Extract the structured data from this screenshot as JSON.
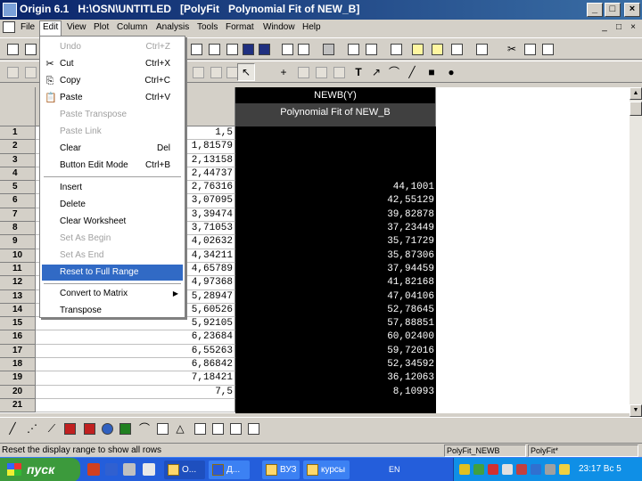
{
  "window": {
    "title": "Origin 6.1   H:\\OSN\\UNTITLED   [PolyFit   Polynomial Fit of NEW_B]",
    "minimize": "_",
    "maximize": "□",
    "close": "×"
  },
  "menubar": {
    "items": [
      "File",
      "Edit",
      "View",
      "Plot",
      "Column",
      "Analysis",
      "Tools",
      "Format",
      "Window",
      "Help"
    ],
    "active": "Edit",
    "mdi_controls": [
      "_",
      "□",
      "×"
    ]
  },
  "edit_menu": {
    "items": [
      {
        "label": "Undo",
        "shortcut": "Ctrl+Z",
        "enabled": false,
        "icon": ""
      },
      {
        "label": "Cut",
        "shortcut": "Ctrl+X",
        "enabled": true,
        "icon": "✂"
      },
      {
        "label": "Copy",
        "shortcut": "Ctrl+C",
        "enabled": true,
        "icon": "⎘"
      },
      {
        "label": "Paste",
        "shortcut": "Ctrl+V",
        "enabled": true,
        "icon": "📋"
      },
      {
        "label": "Paste Transpose",
        "shortcut": "",
        "enabled": false,
        "icon": ""
      },
      {
        "label": "Paste Link",
        "shortcut": "",
        "enabled": false,
        "icon": ""
      },
      {
        "label": "Clear",
        "shortcut": "Del",
        "enabled": true,
        "icon": ""
      },
      {
        "label": "Button Edit Mode",
        "shortcut": "Ctrl+B",
        "enabled": true,
        "icon": ""
      },
      {
        "label": "Insert",
        "shortcut": "",
        "enabled": true,
        "icon": ""
      },
      {
        "label": "Delete",
        "shortcut": "",
        "enabled": true,
        "icon": ""
      },
      {
        "label": "Clear Worksheet",
        "shortcut": "",
        "enabled": true,
        "icon": ""
      },
      {
        "label": "Set As Begin",
        "shortcut": "",
        "enabled": false,
        "icon": ""
      },
      {
        "label": "Set As End",
        "shortcut": "",
        "enabled": false,
        "icon": ""
      },
      {
        "label": "Reset to Full Range",
        "shortcut": "",
        "enabled": true,
        "icon": "",
        "highlighted": true
      },
      {
        "label": "Convert to Matrix",
        "shortcut": "",
        "enabled": true,
        "icon": "",
        "submenu": true
      },
      {
        "label": "Transpose",
        "shortcut": "",
        "enabled": true,
        "icon": ""
      }
    ]
  },
  "worksheet": {
    "column_c": {
      "name": "NEWB(Y)",
      "label": "Polynomial Fit of NEW_B"
    },
    "row_numbers": [
      "1",
      "2",
      "3",
      "4",
      "5",
      "6",
      "7",
      "8",
      "9",
      "10",
      "11",
      "12",
      "13",
      "14",
      "15",
      "16",
      "17",
      "18",
      "19",
      "20",
      "21"
    ],
    "column_b_values": [
      "1,5",
      "1,81579",
      "2,13158",
      "2,44737",
      "2,76316",
      "3,07095",
      "3,39474",
      "3,71053",
      "4,02632",
      "4,34211",
      "4,65789",
      "4,97368",
      "5,28947",
      "5,60526",
      "5,92105",
      "6,23684",
      "6,55263",
      "6,86842",
      "7,18421",
      "7,5",
      ""
    ],
    "column_c_values": [
      "",
      "",
      "",
      "",
      "44,1001",
      "42,55129",
      "39,82878",
      "37,23449",
      "35,71729",
      "35,87306",
      "37,94459",
      "41,82168",
      "47,04106",
      "52,78645",
      "57,88851",
      "60,02400",
      "59,72016",
      "52,34592",
      "36,12063",
      "8,10993",
      ""
    ]
  },
  "statusbar": {
    "message": "Reset the display range to show all rows",
    "panel1": "PolyFit_NEWB",
    "panel2": "PolyFit*"
  },
  "taskbar": {
    "start_label": "пуск",
    "tasks": [
      "O...",
      "Д...",
      "ВУЗ",
      "курсы"
    ],
    "language": "EN",
    "clock": "23:17 Вс 5"
  }
}
